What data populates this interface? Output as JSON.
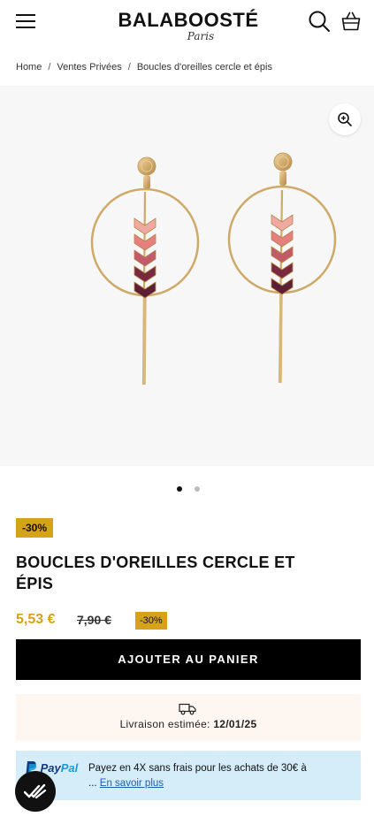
{
  "header": {
    "logo_main": "BALABOOSTÉ",
    "logo_sub": "Paris",
    "menu_icon": "hamburger-menu-icon",
    "search_icon": "search-icon",
    "cart_icon": "shopping-basket-icon"
  },
  "breadcrumb": {
    "items": [
      "Home",
      "Ventes Privées",
      "Boucles d'oreilles cercle et épis"
    ],
    "separator": "/"
  },
  "gallery": {
    "zoom_icon": "zoom-in-icon",
    "image_alt": "earrings-product-image",
    "slide_count": 2,
    "active_slide": 1
  },
  "product": {
    "discount_badge": "-30%",
    "title": "BOUCLES D'OREILLES CERCLE ET ÉPIS",
    "price_sale": "5,53 €",
    "price_old": "7,90 €",
    "price_badge": "-30%",
    "add_to_cart": "AJOUTER AU PANIER"
  },
  "delivery": {
    "icon": "delivery-truck-icon",
    "label": "Livraison estimée:",
    "date": "12/01/25"
  },
  "paypal": {
    "logo_part1": "Pay",
    "logo_part2": "Pal",
    "text": "Payez en 4X sans frais pour les achats de 30€ à",
    "text_cont": "...",
    "link": "En savoir plus"
  },
  "colors": {
    "accent": "#d6a318",
    "button": "#000000",
    "delivery_bg": "#fdf6f1",
    "paypal_bg": "#d5ecf9"
  }
}
